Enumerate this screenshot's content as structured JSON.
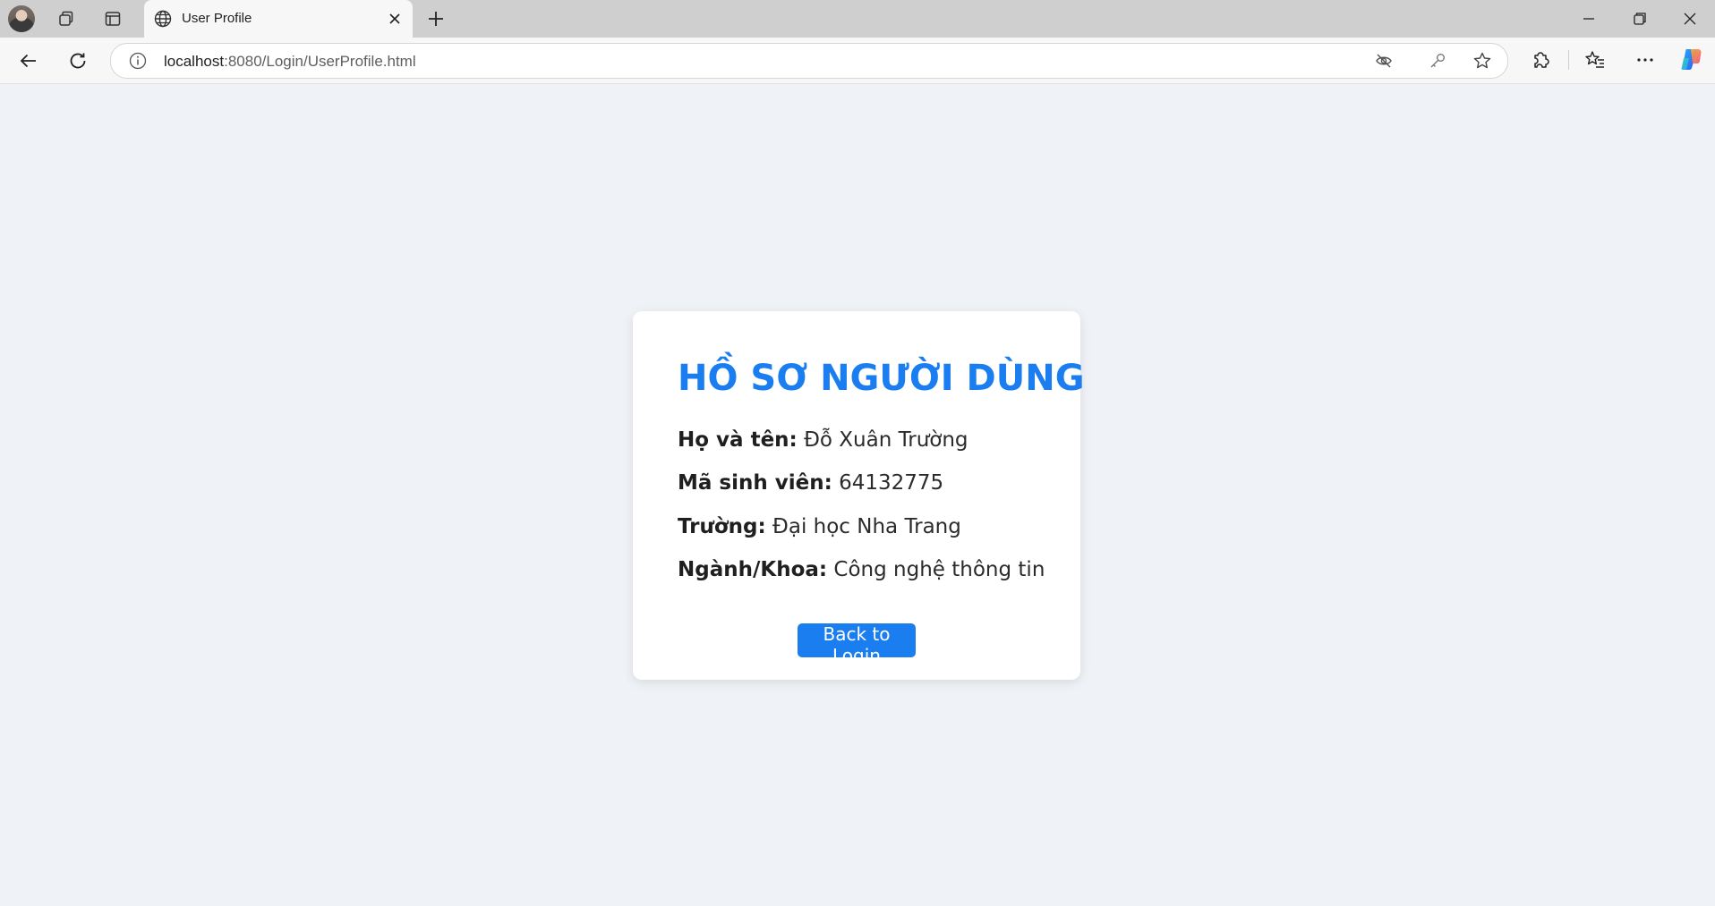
{
  "browser": {
    "tab": {
      "title": "User Profile"
    },
    "address": {
      "host": "localhost",
      "path": ":8080/Login/UserProfile.html"
    },
    "icons": {
      "profile": "avatar",
      "collections": "collections-icon",
      "vertical_tabs": "vertical-tabs-icon",
      "favicon": "globe-icon",
      "close_tab": "close-icon",
      "new_tab": "plus-icon",
      "minimize": "minimize-icon",
      "restore": "restore-icon",
      "close_window": "close-icon",
      "back": "arrow-left-icon",
      "refresh": "refresh-icon",
      "site_info": "info-icon",
      "tracking": "eye-off-icon",
      "password": "key-icon",
      "favorite": "star-icon",
      "extensions": "puzzle-icon",
      "favorites_list": "favorites-list-icon",
      "more": "ellipsis-icon",
      "copilot": "copilot-icon"
    }
  },
  "profile": {
    "heading": "HỒ SƠ NGƯỜI DÙNG",
    "fields": [
      {
        "label": "Họ và tên:",
        "value": "Đỗ Xuân Trường"
      },
      {
        "label": "Mã sinh viên:",
        "value": "64132775"
      },
      {
        "label": "Trường:",
        "value": "Đại học Nha Trang"
      },
      {
        "label": "Ngành/Khoa:",
        "value": "Công nghệ thông tin"
      }
    ],
    "back_button": "Back to Login"
  },
  "colors": {
    "accent": "#1a7ef0",
    "page_background": "#eff2f6",
    "card_background": "#ffffff"
  }
}
